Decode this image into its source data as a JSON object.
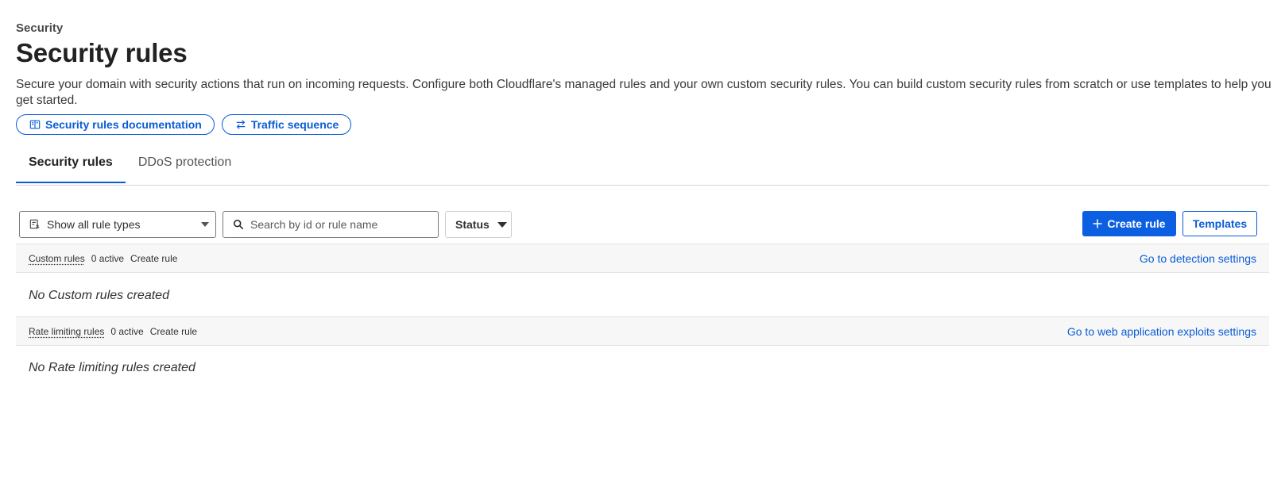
{
  "header": {
    "eyebrow": "Security",
    "title": "Security rules",
    "description": "Secure your domain with security actions that run on incoming requests. Configure both Cloudflare's managed rules and your own custom security rules. You can build custom security rules from scratch or use templates to help you get started."
  },
  "pills": [
    {
      "label": "Security rules documentation",
      "icon": "book-icon"
    },
    {
      "label": "Traffic sequence",
      "icon": "arrows-exchange-icon"
    }
  ],
  "tabs": [
    {
      "label": "Security rules",
      "active": true
    },
    {
      "label": "DDoS protection",
      "active": false
    }
  ],
  "toolbar": {
    "rule_type_select": "Show all rule types",
    "search_placeholder": "Search by id or rule name",
    "status_label": "Status",
    "create_label": "Create rule",
    "templates_label": "Templates"
  },
  "sections": [
    {
      "name": "Custom rules",
      "count": "0 active",
      "create": "Create rule",
      "link": "Go to detection settings",
      "empty": "No Custom rules created"
    },
    {
      "name": "Rate limiting rules",
      "count": "0 active",
      "create": "Create rule",
      "link": "Go to web application exploits settings",
      "empty": "No Rate limiting rules created"
    }
  ],
  "colors": {
    "accent": "#0a5cd6",
    "primary_button": "#0b5fe0",
    "section_bg": "#f7f7f7"
  }
}
